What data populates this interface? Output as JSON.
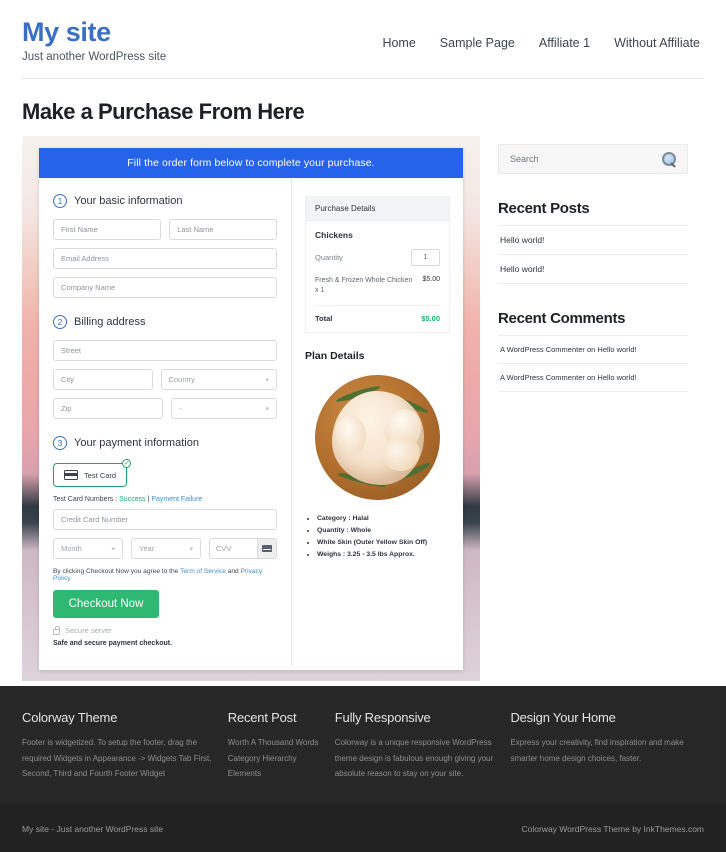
{
  "header": {
    "site_title": "My site",
    "tagline": "Just another WordPress site",
    "nav": [
      {
        "label": "Home"
      },
      {
        "label": "Sample Page"
      },
      {
        "label": "Affiliate 1"
      },
      {
        "label": "Without Affiliate"
      }
    ]
  },
  "page": {
    "title": "Make a Purchase From Here"
  },
  "order_form": {
    "banner": "Fill the order form below to complete your purchase.",
    "step1": {
      "number": "1",
      "label": "Your basic information",
      "first_name_ph": "First Name",
      "last_name_ph": "Last Name",
      "email_ph": "Email Address",
      "company_ph": "Company Name"
    },
    "step2": {
      "number": "2",
      "label": "Billing address",
      "street_ph": "Street",
      "city_ph": "City",
      "country_ph": "Country",
      "zip_ph": "Zip",
      "state_ph": "-"
    },
    "step3": {
      "number": "3",
      "label": "Your payment information",
      "card_tab_label": "Test Card",
      "card_tab_check": "✓",
      "test_card_prefix": "Test Card Numbers : ",
      "test_card_success": "Success",
      "test_card_separator": " | ",
      "test_card_failure": "Payment Failure",
      "card_number_ph": "Credit Card Number",
      "month_ph": "Month",
      "year_ph": "Year",
      "cvv_ph": "CVV",
      "agree_prefix": "By clicking Checkout Now you agree to the ",
      "agree_tos": "Term of Service",
      "agree_mid": " and ",
      "agree_privacy": "Privacy Policy",
      "checkout_label": "Checkout Now",
      "secure_server": "Secure server",
      "safe_note": "Safe and secure payment checkout."
    }
  },
  "summary": {
    "head": "Purchase Details",
    "product": "Chickens",
    "quantity_label": "Quantity",
    "quantity_value": "1",
    "line_item": "Fresh & Frozen Whole Chicken x 1",
    "line_amount": "$5.00",
    "total_label": "Total",
    "total_amount": "$5.00",
    "plan_title": "Plan Details",
    "plan_points": [
      "Category : Halal",
      "Quantity : Whole",
      "White Skin (Outer Yellow Skin Off)",
      "Weighs : 3.25 - 3.5 lbs Approx."
    ]
  },
  "sidebar": {
    "search_placeholder": "Search",
    "recent_posts_title": "Recent Posts",
    "recent_posts": [
      {
        "label": "Hello world!"
      },
      {
        "label": "Hello world!"
      }
    ],
    "recent_comments_title": "Recent Comments",
    "recent_comments": [
      {
        "label": "A WordPress Commenter on Hello world!"
      },
      {
        "label": "A WordPress Commenter on Hello world!"
      }
    ]
  },
  "footer": {
    "columns": [
      {
        "title": "Colorway Theme",
        "body": "Footer is widgetized. To setup the footer, drag the required Widgets in Appearance -> Widgets Tab First, Second, Third and Fourth Footer Widget"
      },
      {
        "title": "Recent Post",
        "items": [
          {
            "label": "Worth A Thousand Words"
          },
          {
            "label": "Category Hierarchy"
          },
          {
            "label": "Elements"
          }
        ]
      },
      {
        "title": "Fully Responsive",
        "body": "Colorway is a unique responsive WordPress theme design is fabulous enough giving your absolute reason to stay on your site."
      },
      {
        "title": "Design Your Home",
        "body": "Express your creativity, find inspiration and make smarter home design choices, faster."
      }
    ],
    "bar_left": "My site - Just another WordPress site",
    "bar_right": "Colorway WordPress Theme by InkThemes.com"
  },
  "colors": {
    "brand_blue": "#3b6fc4",
    "banner_blue": "#2563eb",
    "success_green": "#2eb872",
    "total_green": "#18b563",
    "footer_dark": "#272727"
  }
}
